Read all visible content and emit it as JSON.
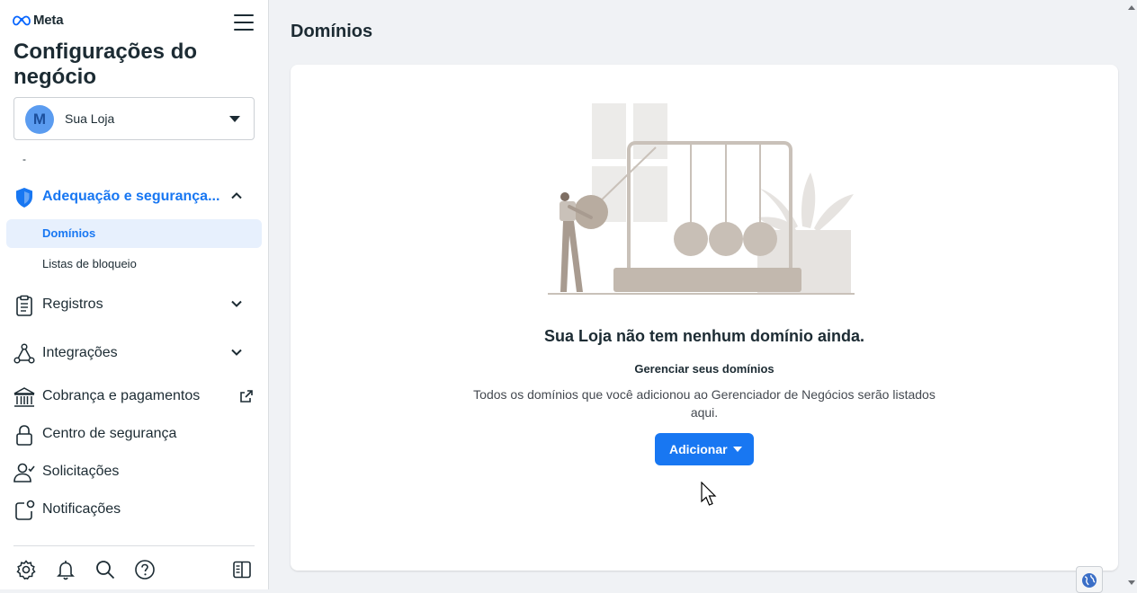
{
  "brand": {
    "name": "Meta"
  },
  "sidebar": {
    "title": "Configurações do negócio",
    "account": {
      "initial": "M",
      "name": "Sua Loja"
    },
    "dash": "-",
    "sections": [
      {
        "label": "Adequação e segurança...",
        "icon": "shield-icon",
        "expanded": true
      },
      {
        "label": "Registros",
        "icon": "clipboard-icon"
      },
      {
        "label": "Integrações",
        "icon": "integrations-icon"
      },
      {
        "label": "Cobrança e pagamentos",
        "icon": "bank-icon",
        "external": true
      },
      {
        "label": "Centro de segurança",
        "icon": "lock-icon"
      },
      {
        "label": "Solicitações",
        "icon": "person-check-icon"
      },
      {
        "label": "Notificações",
        "icon": "notification-icon"
      }
    ],
    "sub_items": [
      {
        "label": "Domínios",
        "selected": true
      },
      {
        "label": "Listas de bloqueio"
      }
    ],
    "bottom_icons": [
      "settings-icon",
      "bell-icon",
      "search-icon",
      "help-icon",
      "panel-toggle-icon"
    ]
  },
  "main": {
    "title": "Domínios",
    "empty_state": {
      "title": "Sua Loja não tem nenhum domínio ainda.",
      "subtitle": "Gerenciar seus domínios",
      "description": "Todos os domínios que você adicionou ao Gerenciador de Negócios serão listados aqui.",
      "button_label": "Adicionar"
    }
  },
  "colors": {
    "accent": "#1877f2",
    "selected_bg": "#e7f0fd",
    "page_bg": "#f0f2f5"
  }
}
